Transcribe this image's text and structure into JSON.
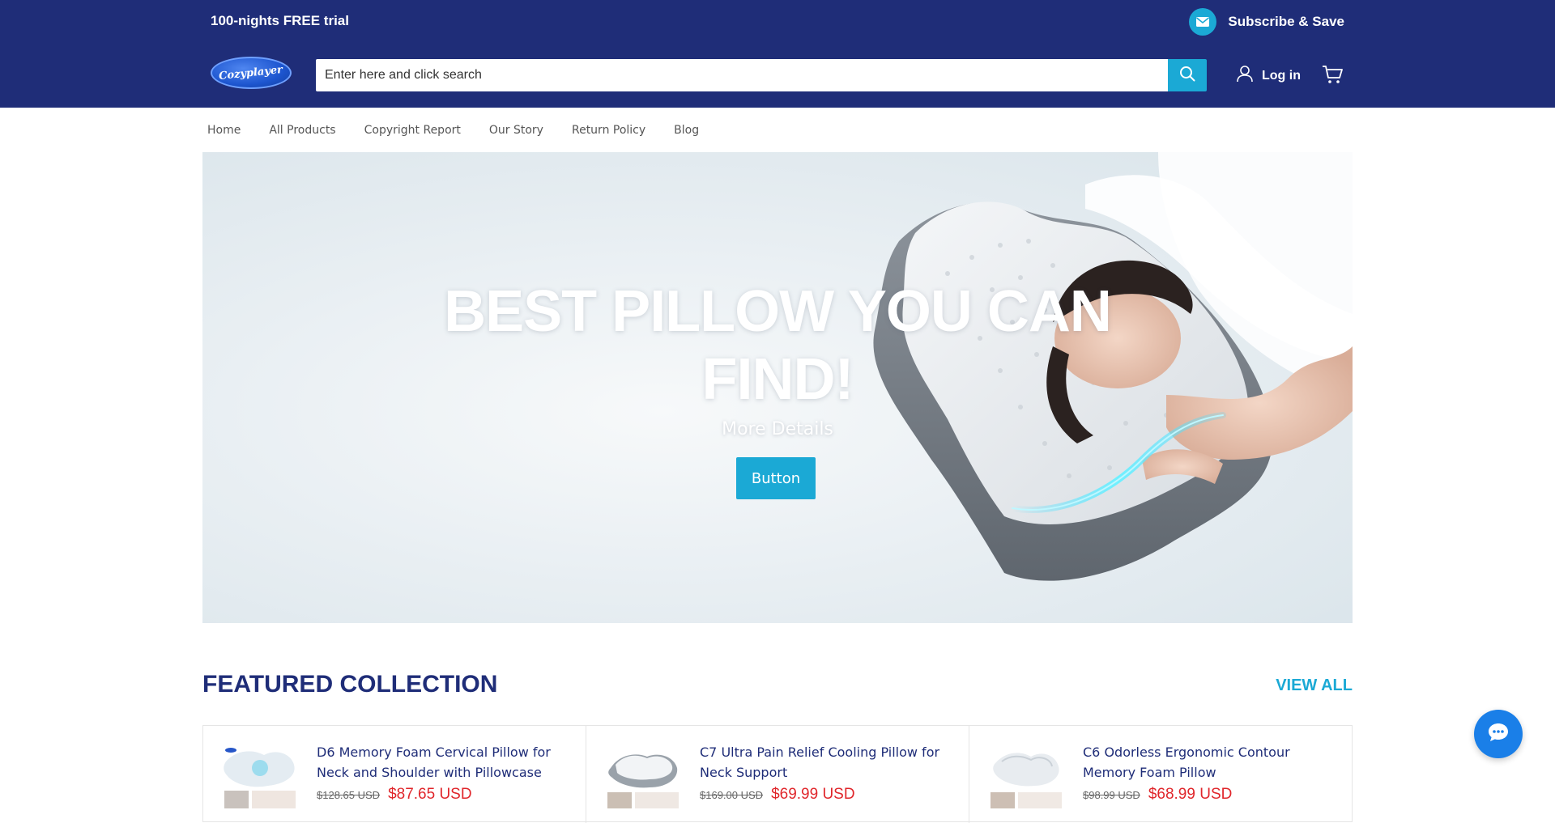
{
  "topbar": {
    "announcement": "100-nights FREE trial",
    "subscribe_label": "Subscribe & Save"
  },
  "header": {
    "logo_text": "Cozyplayer",
    "search_placeholder": "Enter here and click search",
    "login_label": "Log in"
  },
  "nav": {
    "items": [
      {
        "label": "Home"
      },
      {
        "label": "All Products"
      },
      {
        "label": "Copyright Report"
      },
      {
        "label": "Our Story"
      },
      {
        "label": "Return Policy"
      },
      {
        "label": "Blog"
      }
    ]
  },
  "hero": {
    "title": "BEST PILLOW YOU CAN FIND!",
    "subtitle": "More Details",
    "button_label": "Button"
  },
  "featured": {
    "title": "FEATURED COLLECTION",
    "view_all_label": "VIEW ALL",
    "products": [
      {
        "name": "D6 Memory Foam Cervical Pillow for Neck and Shoulder with Pillowcase",
        "old_price": "$128.65 USD",
        "new_price": "$87.65 USD"
      },
      {
        "name": "C7 Ultra Pain Relief Cooling Pillow for Neck Support",
        "old_price": "$169.00 USD",
        "new_price": "$69.99 USD"
      },
      {
        "name": "C6 Odorless Ergonomic Contour Memory Foam Pillow",
        "old_price": "$98.99 USD",
        "new_price": "$68.99 USD"
      }
    ]
  },
  "colors": {
    "header_bg": "#1f2d78",
    "accent": "#1ba9d5",
    "sale_price": "#e0262b",
    "chat_button": "#1a7fe8"
  },
  "icons": [
    "mail-icon",
    "search-icon",
    "user-icon",
    "cart-icon",
    "chat-icon"
  ]
}
